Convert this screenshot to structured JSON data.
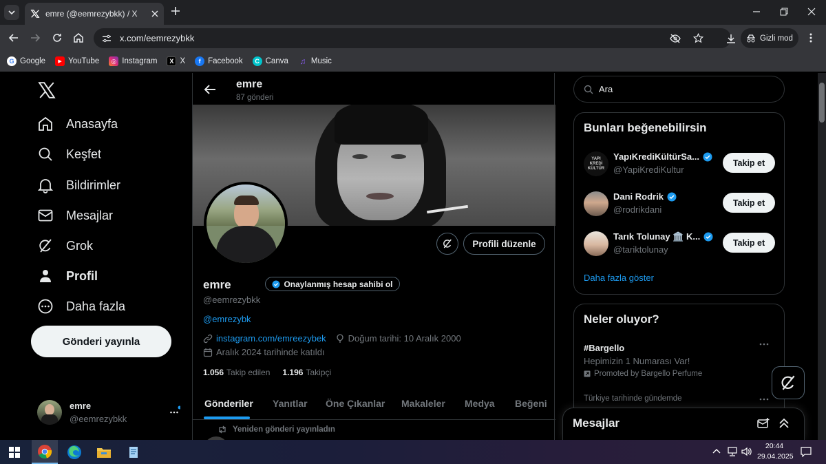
{
  "browser": {
    "tab_title": "emre (@eemrezybkk) / X",
    "url": "x.com/eemrezybkk",
    "incognito_label": "Gizli mod",
    "bookmarks": [
      {
        "label": "Google",
        "icon": "google-icon",
        "color": "#4285f4"
      },
      {
        "label": "YouTube",
        "icon": "youtube-icon",
        "color": "#ff0000"
      },
      {
        "label": "Instagram",
        "icon": "instagram-icon",
        "color": "#d6249f"
      },
      {
        "label": "X",
        "icon": "x-icon",
        "color": "#000000"
      },
      {
        "label": "Facebook",
        "icon": "facebook-icon",
        "color": "#1877f2"
      },
      {
        "label": "Canva",
        "icon": "canva-icon",
        "color": "#00c4cc"
      },
      {
        "label": "Music",
        "icon": "music-icon",
        "color": "#8a5cf5"
      }
    ]
  },
  "sidebar": {
    "items": [
      {
        "label": "Anasayfa",
        "icon": "home-icon"
      },
      {
        "label": "Keşfet",
        "icon": "search-icon"
      },
      {
        "label": "Bildirimler",
        "icon": "bell-icon"
      },
      {
        "label": "Mesajlar",
        "icon": "mail-icon"
      },
      {
        "label": "Grok",
        "icon": "grok-icon"
      },
      {
        "label": "Profil",
        "icon": "person-icon"
      },
      {
        "label": "Daha fazla",
        "icon": "more-circle-icon"
      }
    ],
    "post_button": "Gönderi yayınla",
    "account": {
      "name": "emre",
      "handle": "@eemrezybkk"
    }
  },
  "profile": {
    "header_name": "emre",
    "post_count": "87 gönderi",
    "name": "emre",
    "verify_button": "Onaylanmış hesap sahibi ol",
    "handle": "@eemrezybkk",
    "bio_mention": "@emrezybk",
    "website": "instagram.com/emreezybek",
    "birthday": "Doğum tarihi: 10 Aralık 2000",
    "joined": "Aralık 2024 tarihinde katıldı",
    "following_count": "1.056",
    "following_label": "Takip edilen",
    "followers_count": "1.196",
    "followers_label": "Takipçi",
    "edit_button": "Profili düzenle",
    "tabs": [
      "Gönderiler",
      "Yanıtlar",
      "Öne Çıkanlar",
      "Makaleler",
      "Medya",
      "Beğeni"
    ],
    "repost_note": "Yeniden gönderi yayınladın"
  },
  "right": {
    "search_placeholder": "Ara",
    "suggestions_title": "Bunları beğenebilirsin",
    "suggestions": [
      {
        "name": "YapıKrediKültürSa...",
        "handle": "@YapiKrediKultur",
        "button": "Takip et"
      },
      {
        "name": "Dani Rodrik",
        "handle": "@rodrikdani",
        "button": "Takip et"
      },
      {
        "name": "Tarık Tolunay 🏛️ K...",
        "handle": "@tariktolunay",
        "button": "Takip et"
      }
    ],
    "show_more": "Daha fazla göster",
    "trends_title": "Neler oluyor?",
    "trend": {
      "hashtag": "#Bargello",
      "text": "Hepimizin 1 Numarası Var!",
      "promo": "Promoted by Bargello Perfume"
    },
    "trend2_context": "Türkiye tarihinde gündemde",
    "messages_title": "Mesajlar"
  },
  "taskbar": {
    "time": "20:44",
    "date": "29.04.2025"
  },
  "colors": {
    "accent": "#1d9bf0",
    "background": "#000000",
    "muted": "#71767b"
  }
}
